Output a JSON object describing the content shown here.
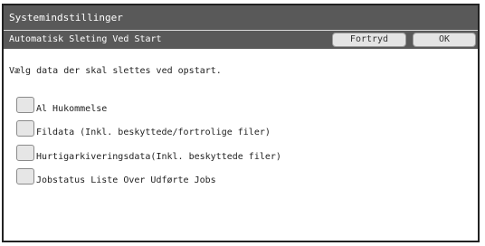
{
  "window": {
    "title": "Systemindstillinger"
  },
  "subheader": {
    "title": "Automatisk Sleting Ved Start",
    "cancel_label": "Fortryd",
    "ok_label": "OK"
  },
  "content": {
    "instruction": "Vælg data der skal slettes ved opstart.",
    "options": [
      {
        "label": "Al Hukommelse",
        "checked": false
      },
      {
        "label": "Fildata (Inkl. beskyttede/fortrolige filer)",
        "checked": false
      },
      {
        "label": "Hurtigarkiveringsdata(Inkl. beskyttede filer)",
        "checked": false
      },
      {
        "label": "Jobstatus Liste Over Udførte Jobs",
        "checked": false
      }
    ]
  },
  "colors": {
    "header_bg": "#595959",
    "button_bg": "#e4e4e4",
    "checkbox_bg": "#e6e6e6"
  }
}
